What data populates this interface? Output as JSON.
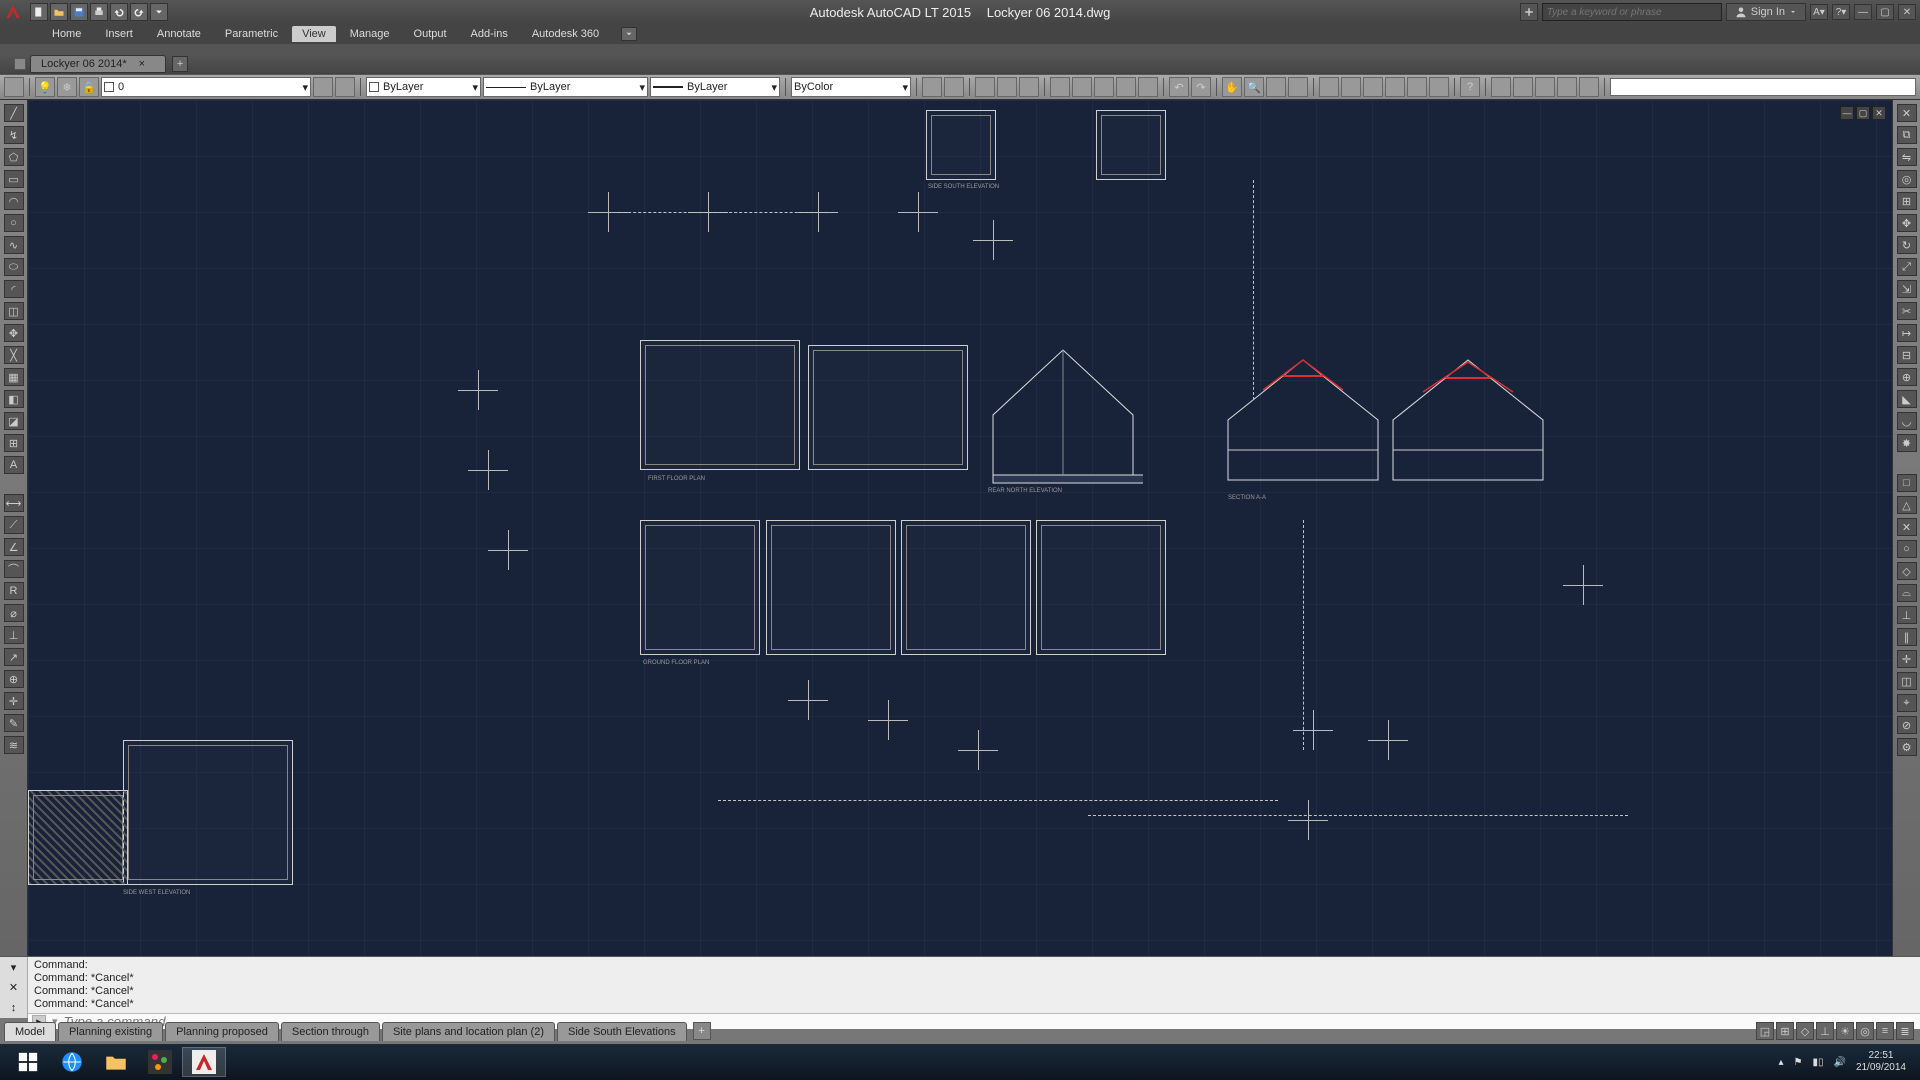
{
  "title": {
    "app": "Autodesk AutoCAD LT 2015",
    "doc": "Lockyer 06 2014.dwg"
  },
  "search": {
    "placeholder": "Type a keyword or phrase"
  },
  "signin": {
    "label": "Sign In"
  },
  "ribbon": {
    "tabs": [
      "Home",
      "Insert",
      "Annotate",
      "Parametric",
      "View",
      "Manage",
      "Output",
      "Add-ins",
      "Autodesk 360"
    ],
    "active": "View"
  },
  "file_tab": {
    "name": "Lockyer 06 2014*"
  },
  "layer": {
    "value": "0"
  },
  "props": {
    "color": "ByLayer",
    "linetype": "ByLayer",
    "lineweight": "ByLayer",
    "plotstyle": "ByColor"
  },
  "canvas_labels": {
    "l1": "FIRST FLOOR PLAN",
    "l2": "GROUND FLOOR PLAN",
    "l3": "SIDE WEST ELEVATION",
    "l4": "REAR NORTH ELEVATION",
    "l5": "SIDE SOUTH ELEVATION",
    "l6": "SECTION A-A"
  },
  "command": {
    "lines": [
      "Command:",
      "Command: *Cancel*",
      "Command: *Cancel*",
      "Command: *Cancel*"
    ],
    "placeholder": "Type a command"
  },
  "layout_tabs": [
    "Model",
    "Planning existing",
    "Planning proposed",
    "Section through",
    "Site plans and location plan (2)",
    "Side South Elevations"
  ],
  "layout_active": "Model",
  "taskbar": {
    "time": "22:51",
    "date": "21/09/2014"
  },
  "colors": {
    "canvas_bg": "#18233a",
    "accent_red": "#d93030"
  }
}
